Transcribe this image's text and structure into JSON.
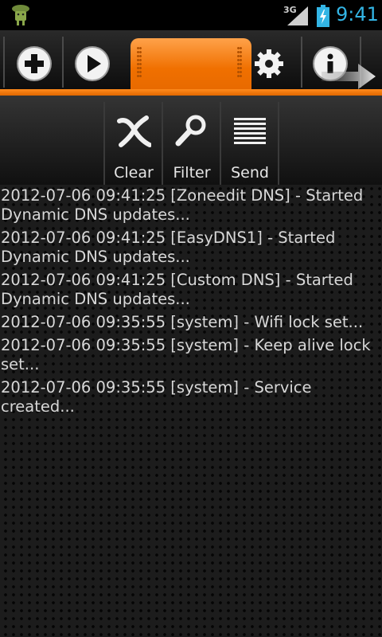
{
  "status_bar": {
    "time": "9:41",
    "network": "3G",
    "time_color": "#33b5e5",
    "icons": [
      "android-app-icon",
      "signal-icon",
      "battery-charging-icon"
    ]
  },
  "tabs": [
    {
      "name": "add",
      "icon": "plus-icon"
    },
    {
      "name": "start",
      "icon": "play-icon"
    },
    {
      "name": "log",
      "icon": "grip-icon",
      "active": true
    },
    {
      "name": "settings",
      "icon": "gear-icon"
    },
    {
      "name": "info",
      "icon": "info-icon"
    }
  ],
  "accent_color": "#f07800",
  "toolbar": {
    "clear_label": "Clear",
    "filter_label": "Filter",
    "send_label": "Send"
  },
  "log": [
    "2012-07-06 09:41:25 [Zoneedit DNS] - Started Dynamic DNS updates...",
    "2012-07-06 09:41:25 [EasyDNS1] - Started Dynamic DNS updates...",
    "2012-07-06 09:41:25 [Custom DNS] - Started Dynamic DNS updates...",
    "2012-07-06 09:35:55 [system] - Wifi lock set...",
    "2012-07-06 09:35:55 [system] - Keep alive lock set...",
    "2012-07-06 09:35:55 [system] - Service created..."
  ]
}
